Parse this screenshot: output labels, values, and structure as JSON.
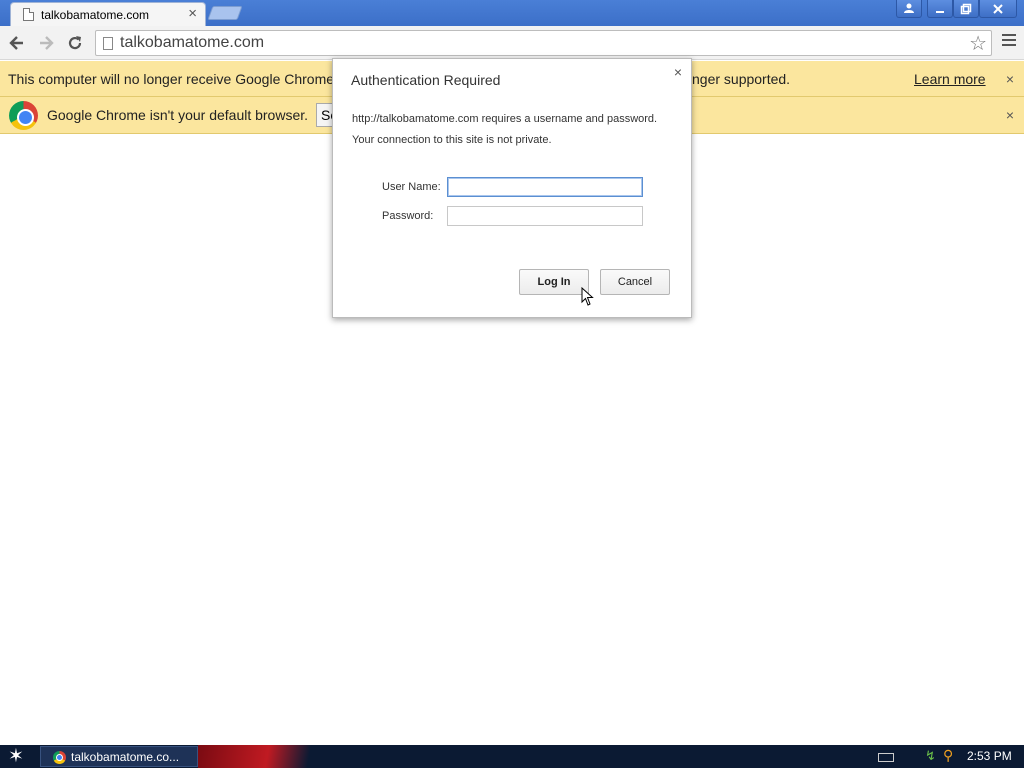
{
  "browser": {
    "tab_title": "talkobamatome.com",
    "tab_close": "×",
    "url": "talkobamatome.com"
  },
  "infobars": {
    "deprecation_message_left": "This computer will no longer receive Google Chrome u",
    "deprecation_message_right": "nger supported.",
    "learn_more": "Learn more",
    "default_browser_message": "Google Chrome isn't your default browser.",
    "set_default_partial": "Se",
    "close": "×"
  },
  "auth_dialog": {
    "title": "Authentication Required",
    "close": "×",
    "line1": "http://talkobamatome.com requires a username and password.",
    "line2": "Your connection to this site is not private.",
    "username_label": "User Name:",
    "password_label": "Password:",
    "username_value": "",
    "password_value": "",
    "login_button": "Log In",
    "cancel_button": "Cancel"
  },
  "taskbar": {
    "start_icon": "start-star-icon",
    "task_label": "talkobamatome.co...",
    "clock": "2:53 PM"
  },
  "icons": {
    "back": "back-arrow-icon",
    "forward": "forward-arrow-icon",
    "reload": "reload-icon",
    "star": "bookmark-star-icon",
    "menu": "hamburger-menu-icon"
  },
  "colors": {
    "titlebar": "#3c6fc8",
    "infobar": "#fbe69e",
    "taskbar": "#0b1a33"
  }
}
